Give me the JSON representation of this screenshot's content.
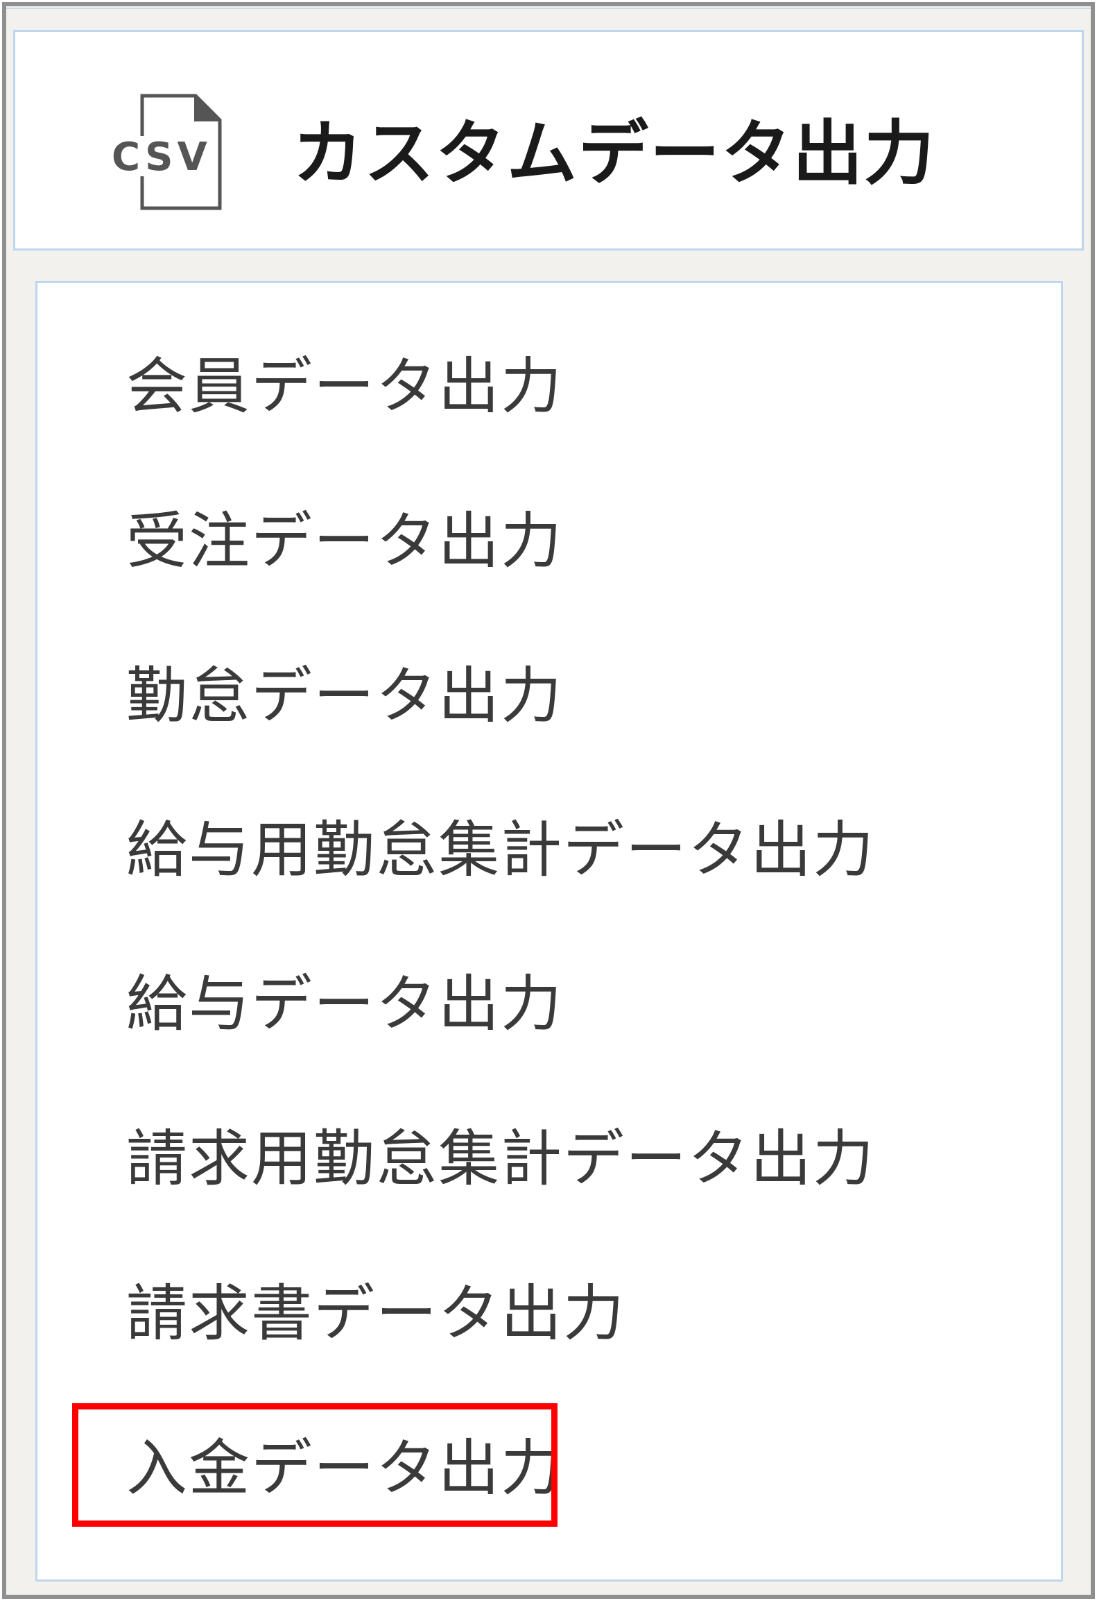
{
  "header": {
    "title": "カスタムデータ出力",
    "icon_text": "CSV",
    "icon": "csv-file-icon"
  },
  "menu": {
    "items": [
      {
        "label": "会員データ出力"
      },
      {
        "label": "受注データ出力"
      },
      {
        "label": "勤怠データ出力"
      },
      {
        "label": "給与用勤怠集計データ出力"
      },
      {
        "label": "給与データ出力"
      },
      {
        "label": "請求用勤怠集計データ出力"
      },
      {
        "label": "請求書データ出力"
      },
      {
        "label": "入金データ出力"
      }
    ],
    "highlighted_index": 7
  },
  "colors": {
    "frame_border": "#8f8f8f",
    "panel_border": "#bfd6ef",
    "background": "#f2f1ee",
    "highlight": "#ff0000",
    "title_text": "#1a1a1a",
    "item_text": "#3a3a3a"
  }
}
